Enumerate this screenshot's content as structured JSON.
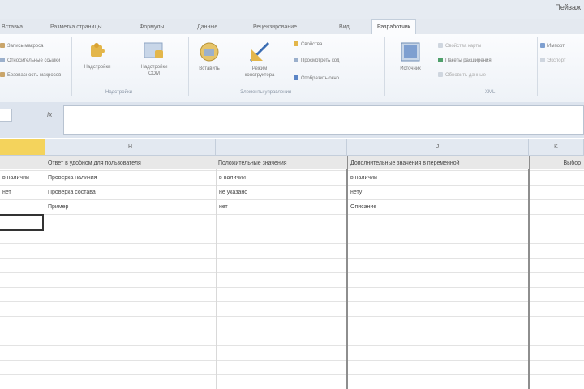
{
  "window": {
    "title": "Пейзаж"
  },
  "ribbon": {
    "tabs": [
      "Вставка",
      "Разметка страницы",
      "Формулы",
      "Данные",
      "Рецензирование",
      "Вид",
      "Разработчик"
    ],
    "active_tab_index": 6,
    "left_group": [
      "Запись макроса",
      "Относительные ссылки",
      "Безопасность макросов"
    ],
    "code_group": {
      "buttons": [
        "Надстройки",
        "Надстройки COM"
      ],
      "label": "Надстройки"
    },
    "controls_group": {
      "buttons": [
        "Вставить",
        "Режим конструктора"
      ],
      "small": [
        "Свойства",
        "Просмотреть код",
        "Отобразить окно"
      ],
      "label": "Элементы управления"
    },
    "xml_group": {
      "source_button": "Источник",
      "small": [
        "Свойства карты",
        "Пакеты расширения",
        "Обновить данные"
      ],
      "label": "XML"
    },
    "right_small": [
      "Импорт",
      "Экспорт"
    ]
  },
  "formula_bar": {
    "fx": "fx",
    "value": ""
  },
  "grid": {
    "columns": [
      "",
      "H",
      "I",
      "J",
      "K"
    ],
    "selected_column_index": 0,
    "headers": [
      "",
      "Ответ в удобном для пользователя",
      "Положительные значения",
      "Дополнительные значения в переменной",
      "Выбор"
    ],
    "rows": [
      [
        "в наличии",
        "Проверка наличия",
        "в наличии",
        "в наличии"
      ],
      [
        "нет",
        "Проверка состава",
        "не указано",
        "нету"
      ],
      [
        "",
        "Пример",
        "нет",
        "Описание"
      ]
    ]
  }
}
